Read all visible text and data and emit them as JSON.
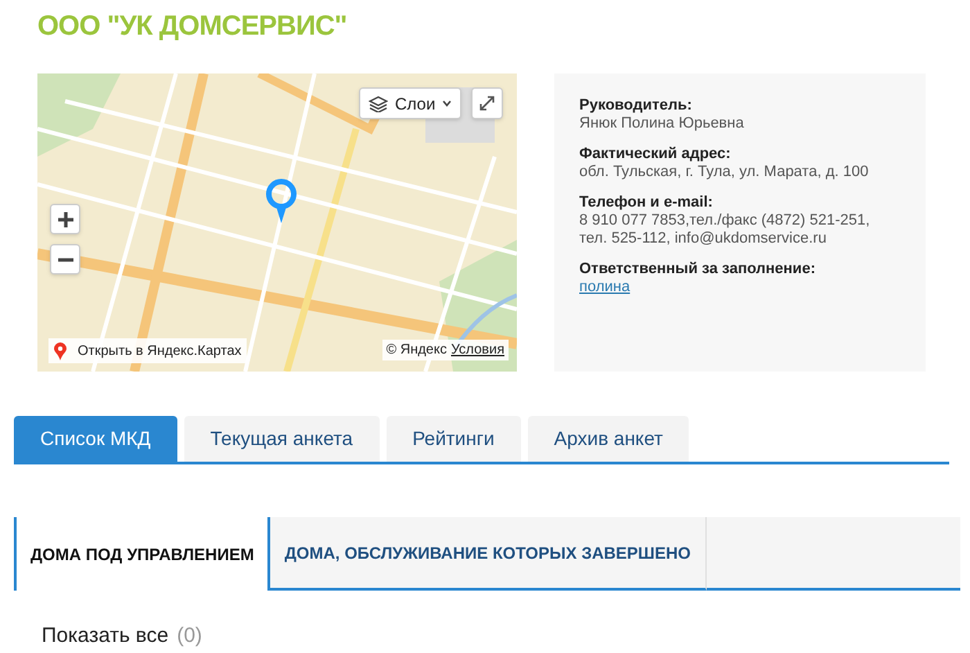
{
  "title": "ООО \"УК ДОМСЕРВИС\"",
  "map": {
    "kind": "picture",
    "layers_button": "Слои",
    "open_link": "Открыть в Яндекс.Картах",
    "copyright": "© Яндекс",
    "terms_link": "Условия"
  },
  "info": [
    {
      "label": "Руководитель:",
      "value": "Янюк Полина Юрьевна",
      "kind": "text"
    },
    {
      "label": "Фактический адрес:",
      "value": "обл. Тульская, г. Тула, ул. Марата, д. 100",
      "kind": "text"
    },
    {
      "label": "Телефон и e-mail:",
      "value": "8 910 077 7853,тел./факс (4872) 521-251, тел. 525-112, info@ukdomservice.ru",
      "kind": "text"
    },
    {
      "label": "Ответственный за заполнение:",
      "value": "полина",
      "kind": "link"
    }
  ],
  "tabs": [
    {
      "label": "Список МКД",
      "selected": true
    },
    {
      "label": "Текущая анкета",
      "selected": false
    },
    {
      "label": "Рейтинги",
      "selected": false
    },
    {
      "label": "Архив анкет",
      "selected": false
    }
  ],
  "subtabs": [
    {
      "label": "ДОМА ПОД УПРАВЛЕНИЕМ",
      "selected": true
    },
    {
      "label": "ДОМА, ОБСЛУЖИВАНИЕ КОТОРЫХ ЗАВЕРШЕНО",
      "selected": false
    }
  ],
  "show_all": {
    "label": "Показать все",
    "count": "(0)"
  }
}
